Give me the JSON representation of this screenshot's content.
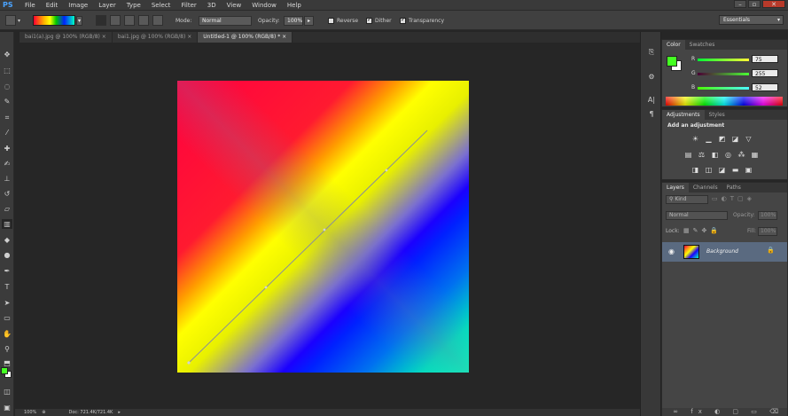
{
  "app": {
    "logo": "PS"
  },
  "menu": [
    "File",
    "Edit",
    "Image",
    "Layer",
    "Type",
    "Select",
    "Filter",
    "3D",
    "View",
    "Window",
    "Help"
  ],
  "options": {
    "mode_label": "Mode:",
    "mode_value": "Normal",
    "opacity_label": "Opacity:",
    "opacity_value": "100%",
    "reverse_label": "Reverse",
    "dither_label": "Dither",
    "transparency_label": "Transparency",
    "reverse_checked": false,
    "dither_checked": true,
    "transparency_checked": true
  },
  "workspace": "Essentials",
  "tabs": [
    {
      "label": "bai1(a).jpg @ 100% (RGB/8)",
      "active": false
    },
    {
      "label": "bai1.jpg @ 100% (RGB/8)",
      "active": false
    },
    {
      "label": "Untitled-1 @ 100% (RGB/8) *",
      "active": true
    }
  ],
  "tab_close": "×",
  "tools": [
    "move-tool",
    "marquee-tool",
    "lasso-tool",
    "quick-select-tool",
    "crop-tool",
    "eyedropper-tool",
    "spot-heal-tool",
    "brush-tool",
    "clone-stamp-tool",
    "history-brush-tool",
    "eraser-tool",
    "gradient-tool",
    "blur-tool",
    "dodge-tool",
    "pen-tool",
    "type-tool",
    "path-select-tool",
    "shape-tool",
    "hand-tool",
    "zoom-tool"
  ],
  "colors": {
    "foreground": "#44ff22",
    "background": "#ffffff",
    "accent": "#5a6a80"
  },
  "status": {
    "zoom": "100%",
    "doc": "Doc: 721.4K/721.4K"
  },
  "color_panel": {
    "tabs": [
      "Color",
      "Swatches"
    ],
    "r_label": "R",
    "g_label": "G",
    "b_label": "B",
    "r": "75",
    "g": "255",
    "b": "52"
  },
  "adjustments_panel": {
    "tabs": [
      "Adjustments",
      "Styles"
    ],
    "title": "Add an adjustment"
  },
  "layers_panel": {
    "tabs": [
      "Layers",
      "Channels",
      "Paths"
    ],
    "kind": "Kind",
    "blend_mode": "Normal",
    "opacity_label": "Opacity:",
    "opacity_value": "100%",
    "lock_label": "Lock:",
    "fill_label": "Fill:",
    "fill_value": "100%",
    "layer_name": "Background"
  }
}
